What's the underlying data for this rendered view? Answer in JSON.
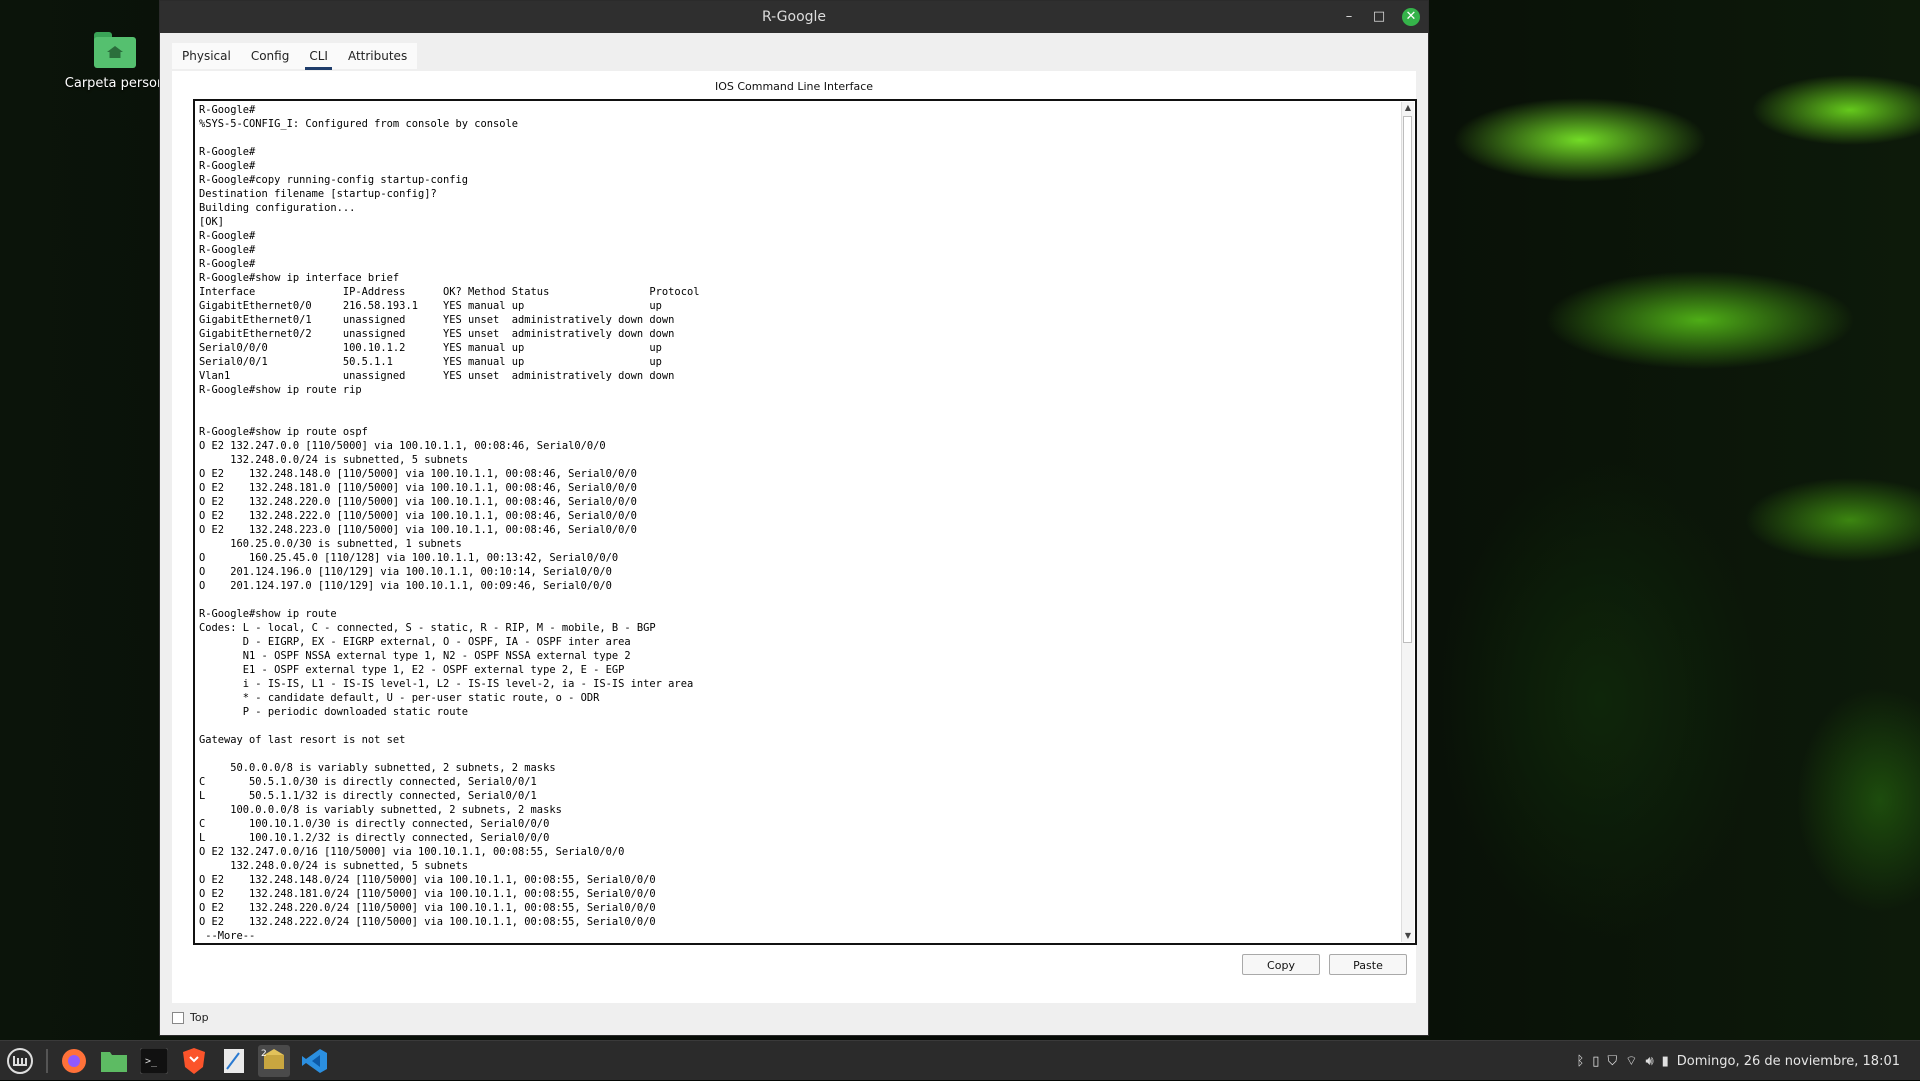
{
  "desktop": {
    "icon_label": "Carpeta person"
  },
  "window": {
    "title": "R-Google",
    "controls": {
      "minimize": "–",
      "maximize": "□",
      "close": "✕"
    }
  },
  "tabs": [
    {
      "label": "Physical",
      "active": false
    },
    {
      "label": "Config",
      "active": false
    },
    {
      "label": "CLI",
      "active": true
    },
    {
      "label": "Attributes",
      "active": false
    }
  ],
  "cli": {
    "title": "IOS Command Line Interface",
    "output": "R-Google#\n%SYS-5-CONFIG_I: Configured from console by console\n\nR-Google#\nR-Google#\nR-Google#copy running-config startup-config\nDestination filename [startup-config]?\nBuilding configuration...\n[OK]\nR-Google#\nR-Google#\nR-Google#\nR-Google#show ip interface brief\nInterface              IP-Address      OK? Method Status                Protocol\nGigabitEthernet0/0     216.58.193.1    YES manual up                    up\nGigabitEthernet0/1     unassigned      YES unset  administratively down down\nGigabitEthernet0/2     unassigned      YES unset  administratively down down\nSerial0/0/0            100.10.1.2      YES manual up                    up\nSerial0/0/1            50.5.1.1        YES manual up                    up\nVlan1                  unassigned      YES unset  administratively down down\nR-Google#show ip route rip\n\n\nR-Google#show ip route ospf\nO E2 132.247.0.0 [110/5000] via 100.10.1.1, 00:08:46, Serial0/0/0\n     132.248.0.0/24 is subnetted, 5 subnets\nO E2    132.248.148.0 [110/5000] via 100.10.1.1, 00:08:46, Serial0/0/0\nO E2    132.248.181.0 [110/5000] via 100.10.1.1, 00:08:46, Serial0/0/0\nO E2    132.248.220.0 [110/5000] via 100.10.1.1, 00:08:46, Serial0/0/0\nO E2    132.248.222.0 [110/5000] via 100.10.1.1, 00:08:46, Serial0/0/0\nO E2    132.248.223.0 [110/5000] via 100.10.1.1, 00:08:46, Serial0/0/0\n     160.25.0.0/30 is subnetted, 1 subnets\nO       160.25.45.0 [110/128] via 100.10.1.1, 00:13:42, Serial0/0/0\nO    201.124.196.0 [110/129] via 100.10.1.1, 00:10:14, Serial0/0/0\nO    201.124.197.0 [110/129] via 100.10.1.1, 00:09:46, Serial0/0/0\n\nR-Google#show ip route\nCodes: L - local, C - connected, S - static, R - RIP, M - mobile, B - BGP\n       D - EIGRP, EX - EIGRP external, O - OSPF, IA - OSPF inter area\n       N1 - OSPF NSSA external type 1, N2 - OSPF NSSA external type 2\n       E1 - OSPF external type 1, E2 - OSPF external type 2, E - EGP\n       i - IS-IS, L1 - IS-IS level-1, L2 - IS-IS level-2, ia - IS-IS inter area\n       * - candidate default, U - per-user static route, o - ODR\n       P - periodic downloaded static route\n\nGateway of last resort is not set\n\n     50.0.0.0/8 is variably subnetted, 2 subnets, 2 masks\nC       50.5.1.0/30 is directly connected, Serial0/0/1\nL       50.5.1.1/32 is directly connected, Serial0/0/1\n     100.0.0.0/8 is variably subnetted, 2 subnets, 2 masks\nC       100.10.1.0/30 is directly connected, Serial0/0/0\nL       100.10.1.2/32 is directly connected, Serial0/0/0\nO E2 132.247.0.0/16 [110/5000] via 100.10.1.1, 00:08:55, Serial0/0/0\n     132.248.0.0/24 is subnetted, 5 subnets\nO E2    132.248.148.0/24 [110/5000] via 100.10.1.1, 00:08:55, Serial0/0/0\nO E2    132.248.181.0/24 [110/5000] via 100.10.1.1, 00:08:55, Serial0/0/0\nO E2    132.248.220.0/24 [110/5000] via 100.10.1.1, 00:08:55, Serial0/0/0\nO E2    132.248.222.0/24 [110/5000] via 100.10.1.1, 00:08:55, Serial0/0/0\n --More--"
  },
  "buttons": {
    "copy": "Copy",
    "paste": "Paste"
  },
  "top_checkbox": {
    "label": "Top",
    "checked": false
  },
  "taskbar": {
    "apps": [
      {
        "name": "menu-icon",
        "glyph": "m"
      },
      {
        "name": "firefox-icon",
        "glyph": ""
      },
      {
        "name": "files-icon",
        "glyph": ""
      },
      {
        "name": "terminal-icon",
        "glyph": ">_"
      },
      {
        "name": "brave-icon",
        "glyph": ""
      },
      {
        "name": "writer-icon",
        "glyph": ""
      },
      {
        "name": "packet-tracer-icon",
        "glyph": "2"
      },
      {
        "name": "vscode-icon",
        "glyph": ""
      }
    ],
    "clock": "Domingo, 26 de noviembre, 18:01"
  }
}
